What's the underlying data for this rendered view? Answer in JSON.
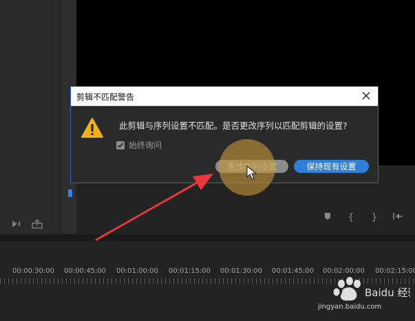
{
  "dialog": {
    "title": "剪辑不匹配警告",
    "message": "此剪辑与序列设置不匹配。是否更改序列以匹配剪辑的设置?",
    "checkbox_label": "始终询问",
    "checkbox_checked": true,
    "buttons": {
      "change": "更改序列设置",
      "keep": "保持现有设置"
    },
    "accent": "#2f7fd9"
  },
  "timeline": {
    "timecodes": [
      "00:00:30:00",
      "00:00:45:00",
      "00:01:00:00",
      "00:01:15:00",
      "00:01:30:00",
      "00:01:45:00",
      "00:02:00:00",
      "00:02:15:00"
    ]
  },
  "watermark": {
    "brand": "Baidu 经验",
    "domain": "jingyan.baidu.com"
  },
  "icons": {
    "left_panel": [
      "play-audio-icon",
      "export-icon"
    ],
    "monitor": [
      "marker-icon",
      "mark-in-icon",
      "mark-out-icon",
      "go-to-in-icon"
    ],
    "dialog": [
      "warning-icon",
      "close-icon",
      "check-icon"
    ]
  }
}
